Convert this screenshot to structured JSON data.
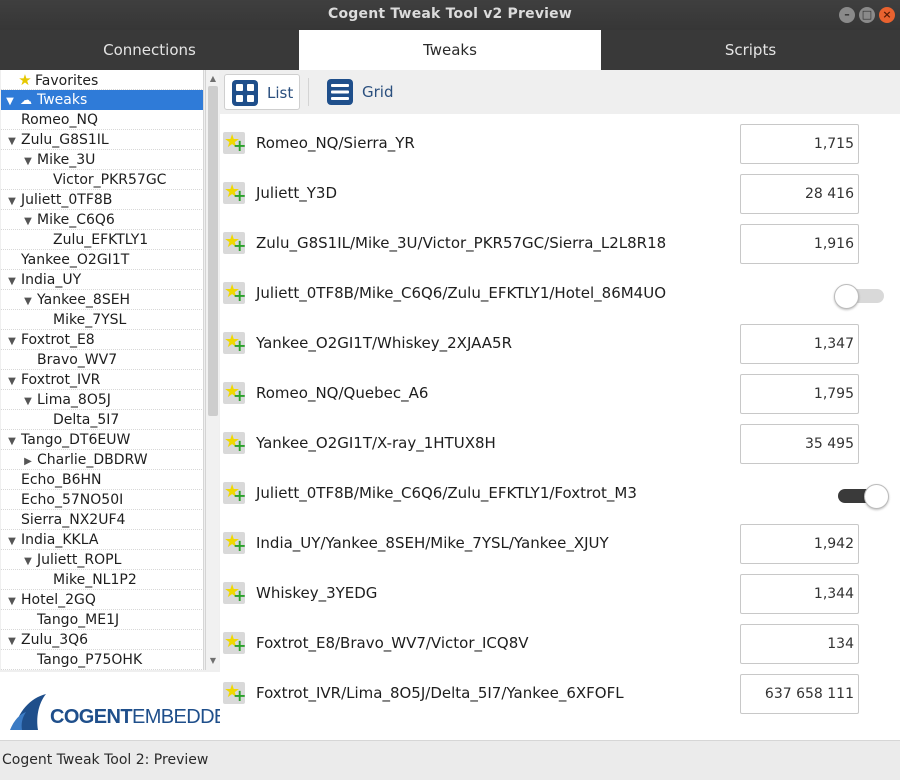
{
  "window": {
    "title": "Cogent Tweak Tool v2 Preview",
    "controls": [
      "minimize-icon",
      "maximize-icon",
      "close-icon"
    ]
  },
  "tabs": [
    {
      "label": "Connections",
      "active": false
    },
    {
      "label": "Tweaks",
      "active": true
    },
    {
      "label": "Scripts",
      "active": false
    }
  ],
  "tree": {
    "items": [
      {
        "label": "Favorites",
        "level": 0,
        "icon": "star-icon"
      },
      {
        "label": "Tweaks",
        "level": 0,
        "expanded": true,
        "icon": "cloud-icon",
        "selected": true
      },
      {
        "label": "Romeo_NQ",
        "level": 1
      },
      {
        "label": "Zulu_G8S1IL",
        "level": 1,
        "expanded": true
      },
      {
        "label": "Mike_3U",
        "level": 2,
        "expanded": true
      },
      {
        "label": "Victor_PKR57GC",
        "level": 3
      },
      {
        "label": "Juliett_0TF8B",
        "level": 1,
        "expanded": true
      },
      {
        "label": "Mike_C6Q6",
        "level": 2,
        "expanded": true
      },
      {
        "label": "Zulu_EFKTLY1",
        "level": 3
      },
      {
        "label": "Yankee_O2GI1T",
        "level": 1
      },
      {
        "label": "India_UY",
        "level": 1,
        "expanded": true
      },
      {
        "label": "Yankee_8SEH",
        "level": 2,
        "expanded": true
      },
      {
        "label": "Mike_7YSL",
        "level": 3
      },
      {
        "label": "Foxtrot_E8",
        "level": 1,
        "expanded": true
      },
      {
        "label": "Bravo_WV7",
        "level": 2
      },
      {
        "label": "Foxtrot_IVR",
        "level": 1,
        "expanded": true
      },
      {
        "label": "Lima_8O5J",
        "level": 2,
        "expanded": true
      },
      {
        "label": "Delta_5I7",
        "level": 3
      },
      {
        "label": "Tango_DT6EUW",
        "level": 1,
        "expanded": true
      },
      {
        "label": "Charlie_DBDRW",
        "level": 2,
        "expanded": false
      },
      {
        "label": "Echo_B6HN",
        "level": 1
      },
      {
        "label": "Echo_57NO50I",
        "level": 1
      },
      {
        "label": "Sierra_NX2UF4",
        "level": 1
      },
      {
        "label": "India_KKLA",
        "level": 1,
        "expanded": true
      },
      {
        "label": "Juliett_ROPL",
        "level": 2,
        "expanded": true
      },
      {
        "label": "Mike_NL1P2",
        "level": 3
      },
      {
        "label": "Hotel_2GQ",
        "level": 1,
        "expanded": true
      },
      {
        "label": "Tango_ME1J",
        "level": 2
      },
      {
        "label": "Zulu_3Q6",
        "level": 1,
        "expanded": true
      },
      {
        "label": "Tango_P75OHK",
        "level": 2
      }
    ]
  },
  "logo": {
    "part1": "COGENT",
    "part2": "EMBEDDED"
  },
  "toolbar": {
    "list_label": "List",
    "grid_label": "Grid",
    "active": "list"
  },
  "tweaks": [
    {
      "label": "Romeo_NQ/Sierra_YR",
      "type": "number",
      "value": "1,715"
    },
    {
      "label": "Juliett_Y3D",
      "type": "number",
      "value": "28 416"
    },
    {
      "label": "Zulu_G8S1IL/Mike_3U/Victor_PKR57GC/Sierra_L2L8R18",
      "type": "number",
      "value": "1,916"
    },
    {
      "label": "Juliett_0TF8B/Mike_C6Q6/Zulu_EFKTLY1/Hotel_86M4UO",
      "type": "toggle",
      "value": false
    },
    {
      "label": "Yankee_O2GI1T/Whiskey_2XJAA5R",
      "type": "number",
      "value": "1,347"
    },
    {
      "label": "Romeo_NQ/Quebec_A6",
      "type": "number",
      "value": "1,795"
    },
    {
      "label": "Yankee_O2GI1T/X-ray_1HTUX8H",
      "type": "number",
      "value": "35 495"
    },
    {
      "label": "Juliett_0TF8B/Mike_C6Q6/Zulu_EFKTLY1/Foxtrot_M3",
      "type": "toggle",
      "value": true
    },
    {
      "label": "India_UY/Yankee_8SEH/Mike_7YSL/Yankee_XJUY",
      "type": "number",
      "value": "1,942"
    },
    {
      "label": "Whiskey_3YEDG",
      "type": "number",
      "value": "1,344"
    },
    {
      "label": "Foxtrot_E8/Bravo_WV7/Victor_ICQ8V",
      "type": "number",
      "value": "134"
    },
    {
      "label": "Foxtrot_IVR/Lima_8O5J/Delta_5I7/Yankee_6XFOFL",
      "type": "number",
      "value": "637 658 111"
    }
  ],
  "status": {
    "text": "Cogent Tweak Tool 2: Preview"
  },
  "colors": {
    "selection": "#2f7bd8",
    "accent": "#2a4f7e",
    "titlebar": "#3c3c3c",
    "close_button": "#e9622f"
  }
}
